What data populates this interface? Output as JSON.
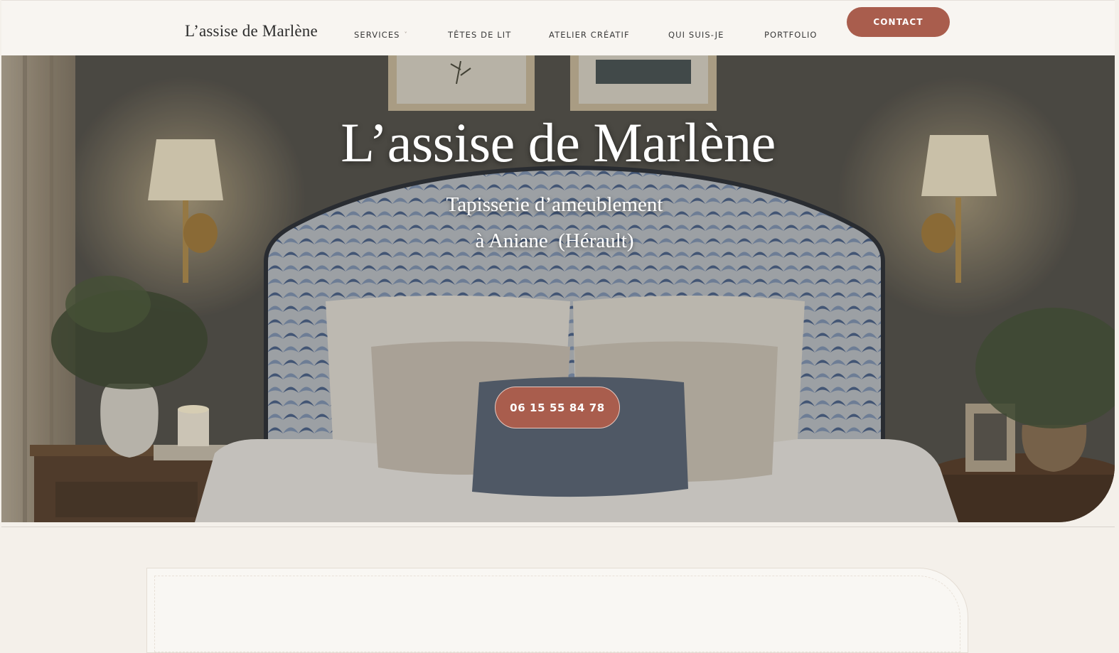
{
  "header": {
    "logo": "L’assise de Marlène",
    "nav": [
      {
        "label": "SERVICES",
        "has_dropdown": true
      },
      {
        "label": "TÊTES DE LIT"
      },
      {
        "label": "ATELIER CRÉATIF"
      },
      {
        "label": "QUI SUIS-JE"
      },
      {
        "label": "PORTFOLIO"
      }
    ],
    "contact_label": "CONTACT"
  },
  "hero": {
    "title": "L’assise de Marlène",
    "subtitle_line1": "Tapisserie d’ameublement",
    "subtitle_line2": "à Aniane  (Hérault)",
    "phone_label": "06 15 55 84 78",
    "background_image": "upholstered headboard bedroom photo"
  },
  "icons": {
    "dropdown": "chevron-down-icon"
  },
  "colors": {
    "accent": "#a95d4d",
    "header_bg": "#f8f5f1",
    "page_bg": "#f4f0ea",
    "text_dark": "#2c2c2c"
  }
}
